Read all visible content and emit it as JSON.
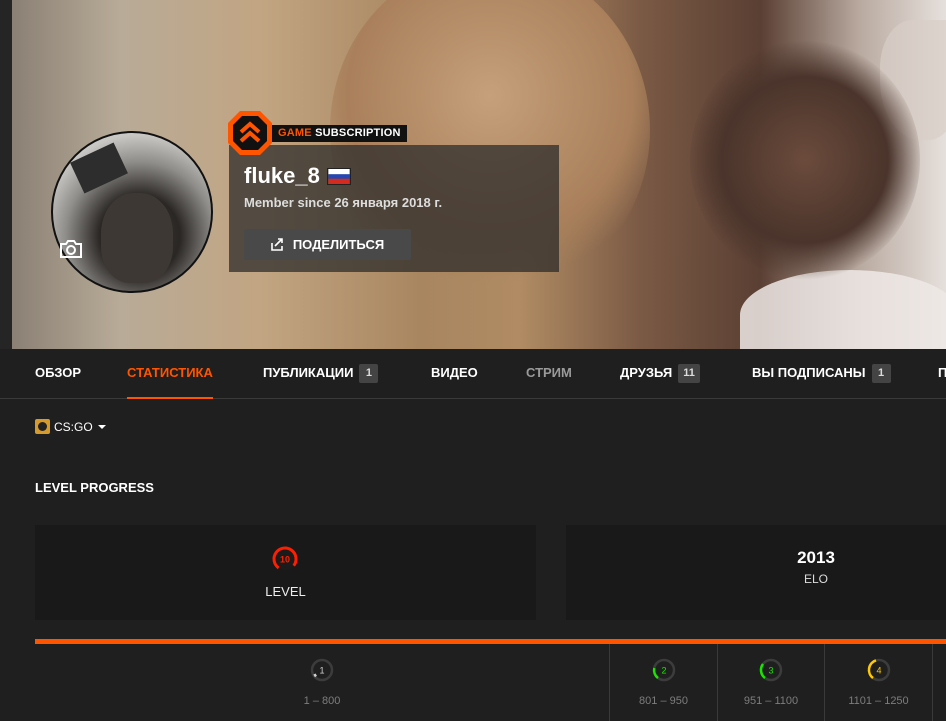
{
  "profile": {
    "badge_game": "GAME",
    "badge_subscription": "SUBSCRIPTION",
    "username": "fluke_8",
    "member_since": "Member since 26 января 2018 г.",
    "share_label": "ПОДЕЛИТЬСЯ"
  },
  "tabs": [
    {
      "label": "ОБЗОР"
    },
    {
      "label": "СТАТИСТИКА",
      "active": true
    },
    {
      "label": "ПУБЛИКАЦИИ",
      "count": "1"
    },
    {
      "label": "ВИДЕО"
    },
    {
      "label": "СТРИМ"
    },
    {
      "label": "ДРУЗЬЯ",
      "count": "11"
    },
    {
      "label": "ВЫ ПОДПИСАНЫ",
      "count": "1"
    },
    {
      "label": "П"
    }
  ],
  "game_selector": {
    "value": "CS:GO"
  },
  "section": {
    "title": "LEVEL PROGRESS"
  },
  "level_card": {
    "level": "10",
    "label": "LEVEL"
  },
  "elo_card": {
    "value": "2013",
    "label": "ELO"
  },
  "levels": [
    {
      "level": "1",
      "range": "1 – 800",
      "color": "#cfcfcf"
    },
    {
      "level": "2",
      "range": "801 – 950",
      "color": "#1ce400"
    },
    {
      "level": "3",
      "range": "951 – 1100",
      "color": "#1ce400"
    },
    {
      "level": "4",
      "range": "1101 – 1250",
      "color": "#ffc800"
    }
  ],
  "colors": {
    "accent": "#ff5500",
    "level10": "#fe1f00"
  }
}
